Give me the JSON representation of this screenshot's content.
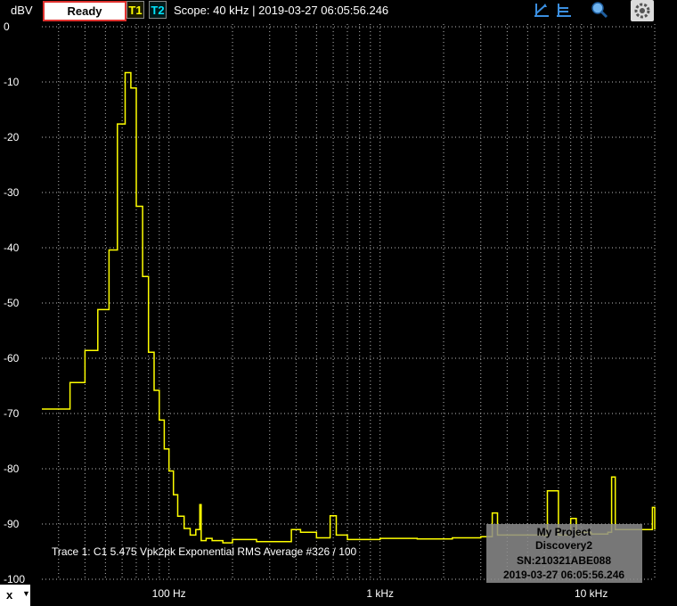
{
  "toolbar": {
    "unit": "dBV",
    "status": "Ready",
    "trace1": "T1",
    "trace2": "T2",
    "scope_info": "Scope: 40 kHz | 2019-03-27 06:05:56.246",
    "icons": [
      "cursor-a-icon",
      "cursor-b-icon",
      "zoom-icon",
      "gear-icon"
    ],
    "colors": {
      "trace1": "#ffff00",
      "trace2": "#00e5ff",
      "status_border": "#e0322f"
    }
  },
  "bottom": {
    "select_value": "x"
  },
  "chart_data": {
    "type": "line",
    "title": "",
    "xlabel": "",
    "ylabel": "dBV",
    "x_scale": "log",
    "xlim": [
      25,
      20000
    ],
    "ylim": [
      -100,
      0
    ],
    "yticks": [
      0,
      -10,
      -20,
      -30,
      -40,
      -50,
      -60,
      -70,
      -80,
      -90,
      -100
    ],
    "ytick_labels": [
      "0",
      "-10",
      "-20",
      "-30",
      "-40",
      "-50",
      "-60",
      "-70",
      "-80",
      "-90",
      "-100"
    ],
    "xticks": [
      100,
      1000,
      10000
    ],
    "xtick_labels": [
      "100 Hz",
      "1 kHz",
      "10 kHz"
    ],
    "grid": true,
    "trace_label": "Trace 1: C1 5.475 Vpk2pk Exponential RMS Average #326 / 100",
    "annotation": [
      "My Project",
      "Discovery2",
      "SN:210321ABE088",
      "2019-03-27 06:05:56.246"
    ],
    "series": [
      {
        "color": "#ffff00",
        "step": true,
        "x": [
          25,
          34,
          40,
          46,
          52,
          57,
          62,
          66,
          70,
          75,
          80,
          85,
          90,
          95,
          100,
          105,
          110,
          118,
          126,
          134,
          140,
          142,
          150,
          160,
          180,
          200,
          260,
          380,
          420,
          500,
          580,
          620,
          700,
          1000,
          1500,
          2200,
          3000,
          3400,
          3600,
          5000,
          6000,
          6200,
          7000,
          8000,
          8500,
          8800,
          10000,
          12000,
          12500,
          13000,
          16000,
          19000,
          19500,
          20000
        ],
        "y": [
          -69.2,
          -64.4,
          -58.6,
          -51.2,
          -40.4,
          -17.6,
          -8.3,
          -11.1,
          -32.5,
          -45.2,
          -58.9,
          -65.8,
          -71.2,
          -76.4,
          -80.4,
          -84.7,
          -88.6,
          -90.8,
          -92.0,
          -91.0,
          -86.5,
          -93.0,
          -92.6,
          -93.0,
          -93.4,
          -92.8,
          -93.2,
          -91.0,
          -91.5,
          -92.5,
          -88.5,
          -92.0,
          -92.8,
          -92.6,
          -92.7,
          -92.5,
          -92.3,
          -88.0,
          -92.0,
          -92.0,
          -92.1,
          -84.0,
          -92.0,
          -89.0,
          -92.0,
          -91.5,
          -91.8,
          -91.5,
          -81.5,
          -91.0,
          -91.0,
          -91.0,
          -87.0,
          -91.0
        ]
      }
    ]
  }
}
